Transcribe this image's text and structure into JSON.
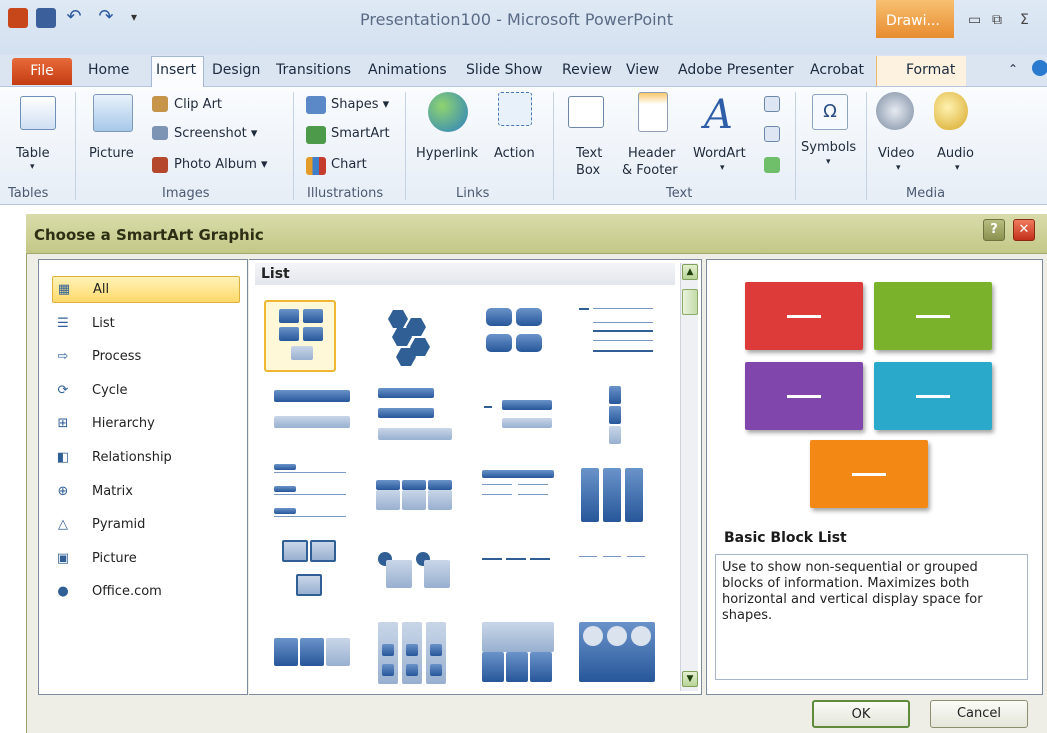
{
  "window": {
    "title": "Presentation100 - Microsoft PowerPoint",
    "contextual_tab": "Drawi...",
    "controls": [
      "▭",
      "⧉",
      "Σ"
    ]
  },
  "ribbon_tabs": [
    "File",
    "Home",
    "Insert",
    "Design",
    "Transitions",
    "Animations",
    "Slide Show",
    "Review",
    "View",
    "Adobe Presenter",
    "Acrobat",
    "Format"
  ],
  "ribbon": {
    "table": "Table",
    "picture": "Picture",
    "clip_art": "Clip Art",
    "screenshot": "Screenshot ▾",
    "photo_album": "Photo Album ▾",
    "shapes": "Shapes ▾",
    "smartart": "SmartArt",
    "chart": "Chart",
    "hyperlink": "Hyperlink",
    "action": "Action",
    "text_box_1": "Text",
    "text_box_2": "Box",
    "header_1": "Header",
    "header_2": "& Footer",
    "wordart": "WordArt",
    "symbols": "Symbols",
    "video": "Video",
    "audio": "Audio",
    "groups": [
      "Tables",
      "Images",
      "Illustrations",
      "Links",
      "Text",
      "Media"
    ]
  },
  "dialog": {
    "title": "Choose a SmartArt Graphic",
    "help": "?",
    "close": "✕",
    "categories": [
      {
        "label": "All",
        "icon": "all-icon",
        "selected": true
      },
      {
        "label": "List",
        "icon": "list-icon"
      },
      {
        "label": "Process",
        "icon": "process-icon"
      },
      {
        "label": "Cycle",
        "icon": "cycle-icon"
      },
      {
        "label": "Hierarchy",
        "icon": "hierarchy-icon"
      },
      {
        "label": "Relationship",
        "icon": "relationship-icon"
      },
      {
        "label": "Matrix",
        "icon": "matrix-icon"
      },
      {
        "label": "Pyramid",
        "icon": "pyramid-icon"
      },
      {
        "label": "Picture",
        "icon": "picture-icon"
      },
      {
        "label": "Office.com",
        "icon": "office-com-icon"
      }
    ],
    "section_header": "List",
    "preview": {
      "title": "Basic Block List",
      "description": "Use to show non-sequential or grouped blocks of information. Maximizes both horizontal and vertical display space for shapes.",
      "colors": [
        "#d73c3c",
        "#7cb230",
        "#7f47a8",
        "#2fa8c8",
        "#ef8a1a"
      ]
    },
    "ok": "OK",
    "cancel": "Cancel"
  }
}
